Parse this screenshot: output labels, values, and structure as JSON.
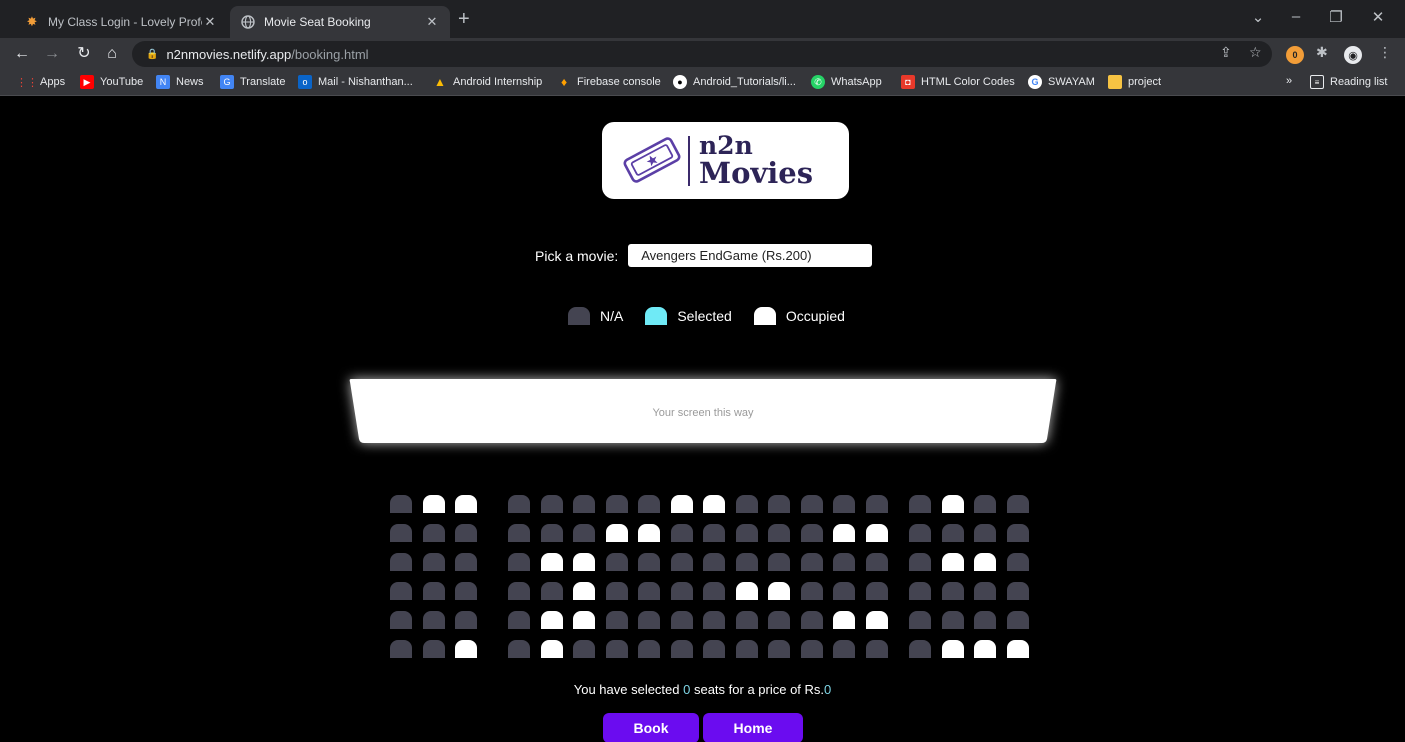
{
  "browser": {
    "tabs": [
      {
        "title": "My Class Login - Lovely Professional U",
        "active": false,
        "favicon": "lpu-icon"
      },
      {
        "title": "Movie Seat Booking",
        "active": true,
        "favicon": "globe-icon"
      }
    ],
    "address": {
      "host": "n2nmovies.netlify.app",
      "path": "/booking.html"
    },
    "bookmarks": [
      {
        "label": "Apps",
        "icon": "apps-grid-icon",
        "color": "#ea4335"
      },
      {
        "label": "YouTube",
        "icon": "youtube-icon",
        "color": "#ff0000"
      },
      {
        "label": "News",
        "icon": "news-icon",
        "color": "#4285f4"
      },
      {
        "label": "Translate",
        "icon": "translate-icon",
        "color": "#4285f4"
      },
      {
        "label": "Mail - Nishanthan...",
        "icon": "outlook-icon",
        "color": "#0a64c8"
      },
      {
        "label": "Android Internship",
        "icon": "drive-icon",
        "color": "#fbbc04"
      },
      {
        "label": "Firebase console",
        "icon": "firebase-icon",
        "color": "#ffa000"
      },
      {
        "label": "Android_Tutorials/li...",
        "icon": "github-icon",
        "color": "#ffffff"
      },
      {
        "label": "WhatsApp",
        "icon": "whatsapp-icon",
        "color": "#25d366"
      },
      {
        "label": "HTML Color Codes",
        "icon": "color-codes-icon",
        "color": "#e8392a"
      },
      {
        "label": "SWAYAM",
        "icon": "google-icon",
        "color": "#ffffff"
      },
      {
        "label": "project",
        "icon": "folder-icon",
        "color": "#f6c343"
      }
    ],
    "overflow_label": "»",
    "reading_list": "Reading list",
    "extension_badge": "0"
  },
  "page": {
    "logo": {
      "line1": "n2n",
      "line2": "Movies"
    },
    "picker": {
      "label": "Pick a movie:",
      "selected": "Avengers EndGame (Rs.200)"
    },
    "legend": [
      {
        "label": "N/A",
        "color": "#444451"
      },
      {
        "label": "Selected",
        "color": "#6feaf6"
      },
      {
        "label": "Occupied",
        "color": "#ffffff"
      }
    ],
    "screen_label": "Your screen this way",
    "seats": {
      "rows": [
        "222 020002220000 222",
        "222 002200000000 222",
        "222 000000000000 222",
        "222 000000000000 222",
        "222 000000000000 222",
        "222 000000000000 222"
      ],
      "occupied": [
        [
          0,
          1
        ],
        [
          0,
          2
        ],
        [
          0,
          8
        ],
        [
          0,
          9
        ],
        [
          0,
          16
        ],
        [
          1,
          6
        ],
        [
          1,
          7
        ],
        [
          1,
          13
        ],
        [
          1,
          14
        ],
        [
          2,
          4
        ],
        [
          2,
          5
        ],
        [
          2,
          16
        ],
        [
          2,
          17
        ],
        [
          3,
          5
        ],
        [
          3,
          10
        ],
        [
          3,
          11
        ],
        [
          4,
          4
        ],
        [
          4,
          5
        ],
        [
          4,
          13
        ],
        [
          4,
          14
        ],
        [
          5,
          2
        ],
        [
          5,
          4
        ],
        [
          5,
          16
        ],
        [
          5,
          17
        ],
        [
          5,
          18
        ]
      ],
      "columns": 19,
      "row_count": 6,
      "color_na": "#444451",
      "color_occupied": "#ffffff"
    },
    "summary": {
      "prefix": "You have selected ",
      "count": "0",
      "middle": " seats for a price of Rs.",
      "price": "0"
    },
    "buttons": {
      "book": "Book",
      "home": "Home"
    },
    "accent": "#6b0cf0"
  }
}
